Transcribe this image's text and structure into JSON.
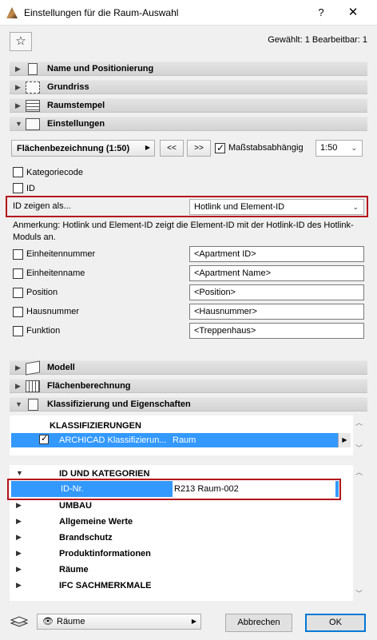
{
  "window": {
    "title": "Einstellungen für die Raum-Auswahl",
    "help": "?",
    "close": "✕"
  },
  "toolbar": {
    "favorite_icon": "star-icon",
    "selected_info": "Gewählt: 1 Bearbeitbar: 1"
  },
  "sections": [
    {
      "label": "Name und Positionierung",
      "expanded": false
    },
    {
      "label": "Grundriss",
      "expanded": false
    },
    {
      "label": "Raumstempel",
      "expanded": false
    },
    {
      "label": "Einstellungen",
      "expanded": true
    },
    {
      "label": "Modell",
      "expanded": false
    },
    {
      "label": "Flächenberechnung",
      "expanded": false
    },
    {
      "label": "Klassifizierung und Eigenschaften",
      "expanded": true
    }
  ],
  "einstellungen": {
    "preset": "Flächenbezeichnung (1:50)",
    "prev": "<<",
    "next": ">>",
    "scale_dependent": {
      "label": "Maßstabsabhängig",
      "checked": true
    },
    "scale": "1:50",
    "kategoriecode": {
      "label": "Kategoriecode",
      "checked": false
    },
    "id": {
      "label": "ID",
      "checked": false
    },
    "id_show_as": {
      "label": "ID zeigen als...",
      "value": "Hotlink und Element-ID"
    },
    "note": "Anmerkung: Hotlink und Element-ID zeigt die Element-ID mit der Hotlink-ID des Hotlink-Moduls an.",
    "fields": [
      {
        "label": "Einheitennummer",
        "checked": false,
        "value": "<Apartment ID>"
      },
      {
        "label": "Einheitenname",
        "checked": false,
        "value": "<Apartment Name>"
      },
      {
        "label": "Position",
        "checked": false,
        "value": "<Position>"
      },
      {
        "label": "Hausnummer",
        "checked": false,
        "value": "<Hausnummer>"
      },
      {
        "label": "Funktion",
        "checked": false,
        "value": "<Treppenhaus>"
      }
    ]
  },
  "klassifizierung": {
    "header": "KLASSIFIZIERUNGEN",
    "row": {
      "system": "ARCHICAD Klassifizierun...",
      "value": "Raum",
      "checked": true
    }
  },
  "properties": {
    "groups": [
      {
        "label": "ID UND KATEGORIEN",
        "expanded": true
      },
      {
        "label": "UMBAU",
        "expanded": false
      },
      {
        "label": "Allgemeine Werte",
        "expanded": false
      },
      {
        "label": "Brandschutz",
        "expanded": false
      },
      {
        "label": "Produktinformationen",
        "expanded": false
      },
      {
        "label": "Räume",
        "expanded": false
      },
      {
        "label": "IFC SACHMERKMALE",
        "expanded": false
      }
    ],
    "id_nr": {
      "label": "ID-Nr.",
      "value": "R213 Raum-002"
    }
  },
  "footer": {
    "layer": "Räume",
    "cancel": "Abbrechen",
    "ok": "OK"
  },
  "colors": {
    "selection": "#3399ff",
    "highlight_border": "#b5121b"
  }
}
